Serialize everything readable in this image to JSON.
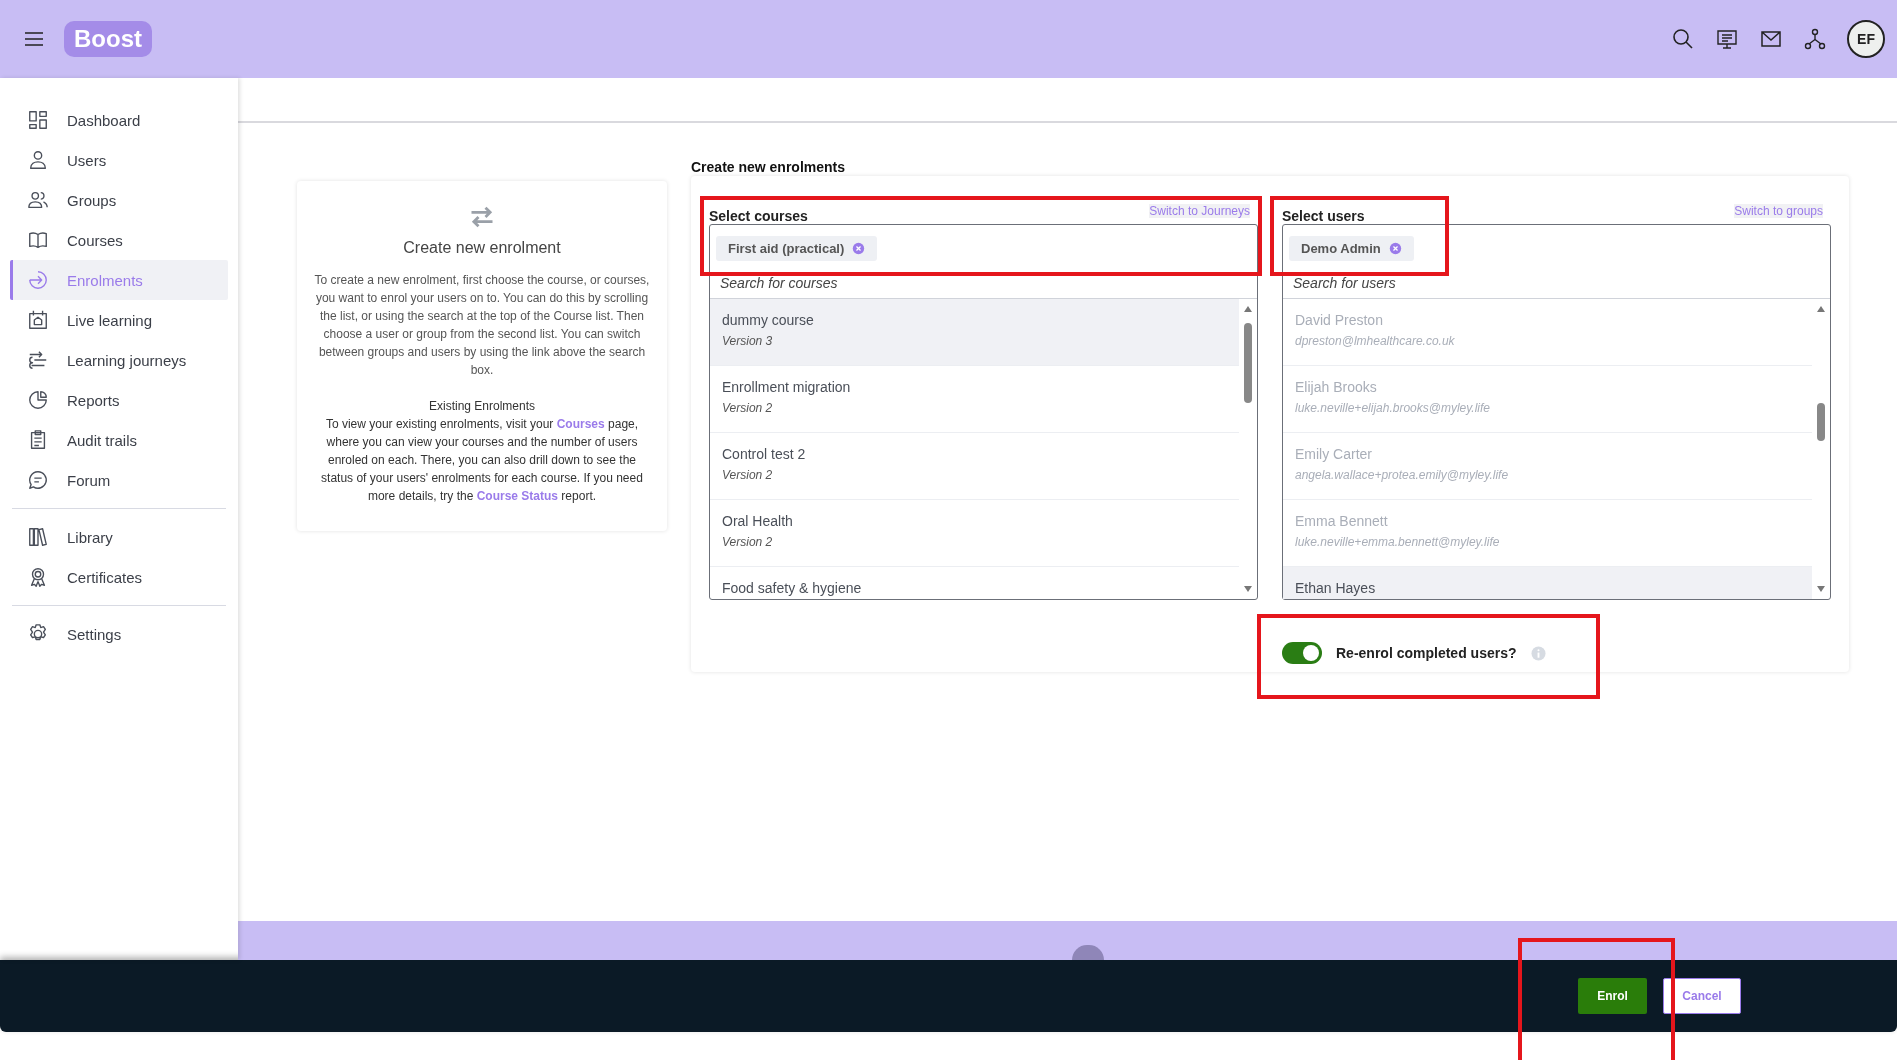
{
  "topbar": {
    "logo": "Boost",
    "avatar": "EF"
  },
  "sidebar": {
    "groups": [
      [
        {
          "label": "Dashboard",
          "selected": false
        },
        {
          "label": "Users",
          "selected": false
        },
        {
          "label": "Groups",
          "selected": false
        },
        {
          "label": "Courses",
          "selected": false
        },
        {
          "label": "Enrolments",
          "selected": true
        },
        {
          "label": "Live learning",
          "selected": false
        },
        {
          "label": "Learning journeys",
          "selected": false
        },
        {
          "label": "Reports",
          "selected": false
        },
        {
          "label": "Audit trails",
          "selected": false
        },
        {
          "label": "Forum",
          "selected": false
        }
      ],
      [
        {
          "label": "Library",
          "selected": false
        },
        {
          "label": "Certificates",
          "selected": false
        }
      ],
      [
        {
          "label": "Settings",
          "selected": false
        }
      ]
    ]
  },
  "info_card": {
    "title": "Create new enrolment",
    "intro": "To create a new enrolment, first choose the course, or courses, you want to enrol your users on to. You can do this by scrolling the list, or using the search at the top of the Course list. Then choose a user or group from the second list. You can switch between groups and users by using the link above the search box.",
    "existing_heading": "Existing Enrolments",
    "existing": [
      {
        "kind": "text",
        "text": "To view your existing enrolments, visit your "
      },
      {
        "kind": "link",
        "text": "Courses"
      },
      {
        "kind": "text",
        "text": " page, where you can view your courses and the number of users enroled on each. There, you can also drill down to see the status of your users' enrolments for each course. If you need more details, try the "
      },
      {
        "kind": "link",
        "text": "Course Status"
      },
      {
        "kind": "text",
        "text": " report."
      }
    ]
  },
  "form": {
    "title": "Create new enrolments",
    "columns": [
      {
        "label": "Select courses",
        "switch_link": "Switch to Journeys",
        "chips": [
          "First aid (practical)"
        ],
        "placeholder": "Search for courses",
        "items": [
          {
            "name": "dummy course",
            "detail": "Version 3",
            "highlighted": true,
            "disabled": false
          },
          {
            "name": "Enrollment migration",
            "detail": "Version 2",
            "highlighted": false,
            "disabled": false
          },
          {
            "name": "Control test 2",
            "detail": "Version 2",
            "highlighted": false,
            "disabled": false
          },
          {
            "name": "Oral Health",
            "detail": "Version 2",
            "highlighted": false,
            "disabled": false
          },
          {
            "name": "Food safety & hygiene",
            "highlighted": false,
            "disabled": false
          }
        ]
      },
      {
        "label": "Select users",
        "switch_link": "Switch to groups",
        "chips": [
          "Demo Admin"
        ],
        "placeholder": "Search for users",
        "items": [
          {
            "name": "David Preston",
            "detail": "dpreston@lmhealthcare.co.uk",
            "highlighted": false,
            "disabled": true
          },
          {
            "name": "Elijah Brooks",
            "detail": "luke.neville+elijah.brooks@myley.life",
            "highlighted": false,
            "disabled": true
          },
          {
            "name": "Emily Carter",
            "detail": "angela.wallace+protea.emily@myley.life",
            "highlighted": false,
            "disabled": true
          },
          {
            "name": "Emma Bennett",
            "detail": "luke.neville+emma.bennett@myley.life",
            "highlighted": false,
            "disabled": true
          },
          {
            "name": "Ethan Hayes",
            "highlighted": true,
            "disabled": false
          }
        ]
      }
    ],
    "reenrol": {
      "label": "Re-enrol completed users?",
      "on": true
    }
  },
  "footer": {
    "buttons": [
      {
        "label": "Enrol",
        "kind": "primary"
      },
      {
        "label": "Cancel",
        "kind": "secondary"
      }
    ]
  }
}
